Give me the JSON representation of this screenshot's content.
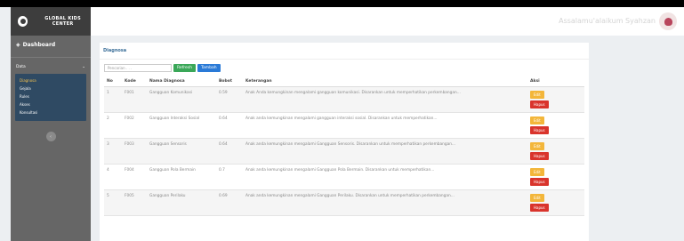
{
  "sidebar": {
    "brand": "GLOBAL KIDS CENTER",
    "dashboard": "Dashboard",
    "data_menu": "Data",
    "items": [
      "Diagnosa",
      "Gejala",
      "Rules",
      "Akses",
      "Konsultasi"
    ]
  },
  "header": {
    "greeting": "Assalamu'alaikum Syahzan"
  },
  "main": {
    "card_title": "Diagnosa",
    "search_placeholder": "Pencarian . . .",
    "refresh_label": "Refresh",
    "add_label": "Tambah",
    "columns": [
      "No",
      "Kode",
      "Nama Diagnosa",
      "Bobot",
      "Keterangan",
      "Aksi"
    ],
    "edit_label": "Edit",
    "delete_label": "Hapus",
    "rows": [
      {
        "no": "1",
        "kode": "F001",
        "nama": "Gangguan Komunikasi",
        "bobot": "0.59",
        "ket": "Anak Anda kemungkinan mengalami gangguan komunikasi. Disarankan untuk memperhatikan perkembangan..."
      },
      {
        "no": "2",
        "kode": "F002",
        "nama": "Gangguan Interaksi Sosial",
        "bobot": "0.64",
        "ket": "Anak anda kemungkinan mengalami gangguan interaksi sosial. Disarankan untuk memperhatikan..."
      },
      {
        "no": "3",
        "kode": "F003",
        "nama": "Gangguan Sensoris",
        "bobot": "0.64",
        "ket": "Anak anda kemungkinan mengalami Gangguan Sensoris. Disarankan untuk memperhatikan perkembangan..."
      },
      {
        "no": "4",
        "kode": "F004",
        "nama": "Gangguan Pola Bermain",
        "bobot": "0.7",
        "ket": "Anak anda kemungkinan mengalami Gangguan Pola Bermain. Disarankan untuk memperhatikan..."
      },
      {
        "no": "5",
        "kode": "F005",
        "nama": "Gangguan Perilaku",
        "bobot": "0.69",
        "ket": "Anak anda kemungkinan mengalami Gangguan Perilaku. Disarankan untuk memperhatikan perkembangan..."
      }
    ]
  }
}
